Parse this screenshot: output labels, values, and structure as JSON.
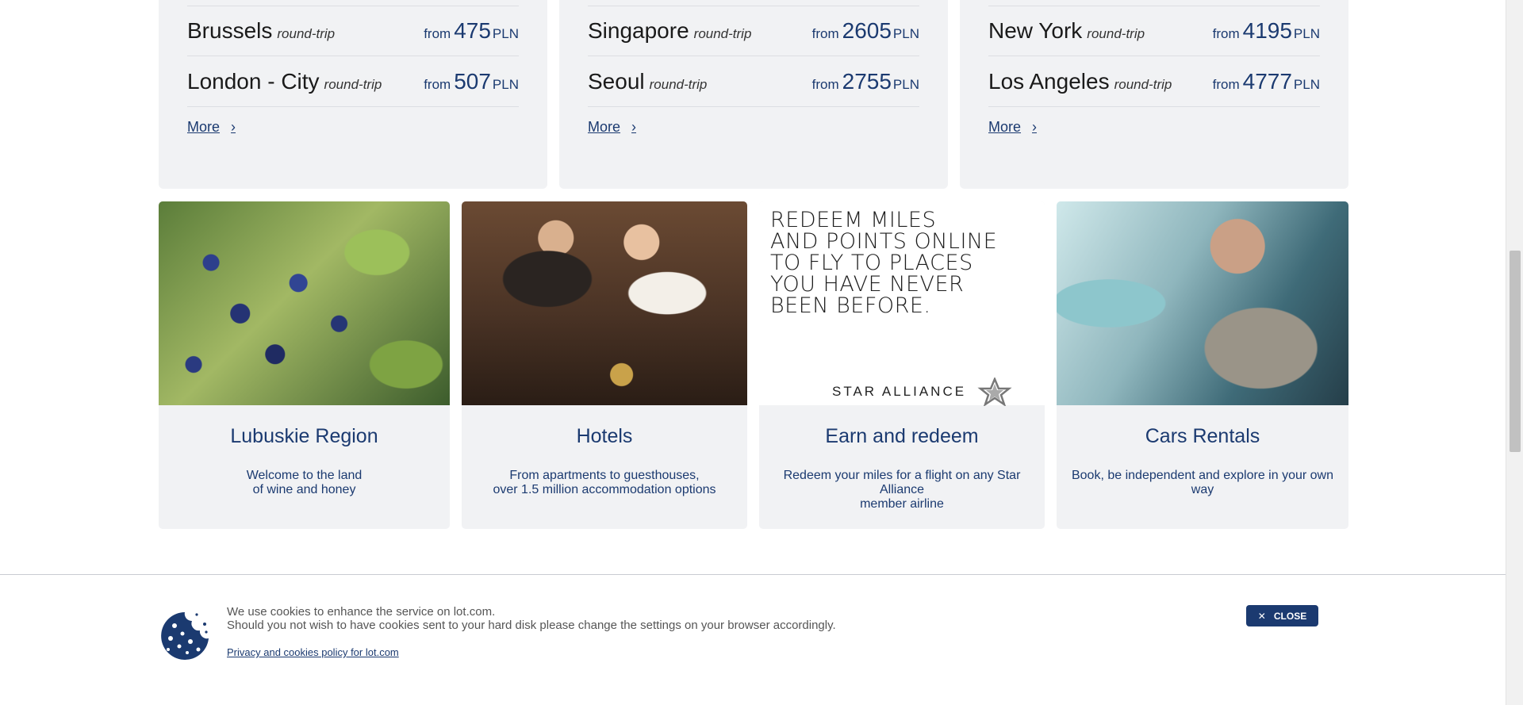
{
  "destinations": [
    {
      "rows": [
        {
          "city": "Brussels",
          "trip": "round-trip",
          "from": "from",
          "price": "475",
          "currency": "PLN"
        },
        {
          "city": "London - City",
          "trip": "round-trip",
          "from": "from",
          "price": "507",
          "currency": "PLN"
        }
      ],
      "more": "More"
    },
    {
      "rows": [
        {
          "city": "Singapore",
          "trip": "round-trip",
          "from": "from",
          "price": "2605",
          "currency": "PLN"
        },
        {
          "city": "Seoul",
          "trip": "round-trip",
          "from": "from",
          "price": "2755",
          "currency": "PLN"
        }
      ],
      "more": "More"
    },
    {
      "rows": [
        {
          "city": "New York",
          "trip": "round-trip",
          "from": "from",
          "price": "4195",
          "currency": "PLN"
        },
        {
          "city": "Los Angeles",
          "trip": "round-trip",
          "from": "from",
          "price": "4777",
          "currency": "PLN"
        }
      ],
      "more": "More"
    }
  ],
  "tiles": [
    {
      "title": "Lubuskie Region",
      "desc_line1": "Welcome to the land",
      "desc_line2": "of wine and honey"
    },
    {
      "title": "Hotels",
      "desc_line1": "From apartments to guesthouses,",
      "desc_line2": "over 1.5 million accommodation options"
    },
    {
      "title": "Earn and redeem",
      "desc_line1": "Redeem your miles for a flight on any Star Alliance",
      "desc_line2": "member airline"
    },
    {
      "title": "Cars Rentals",
      "desc_line1": "Book, be independent and explore in your own way",
      "desc_line2": ""
    }
  ],
  "star_banner": {
    "line1": "REDEEM MILES",
    "line2": "AND POINTS ONLINE",
    "line3": "TO FLY TO PLACES",
    "line4": "YOU HAVE NEVER",
    "line5": "BEEN BEFORE.",
    "brand": "STAR ALLIANCE"
  },
  "cookie": {
    "line1": "We use cookies to enhance the service on lot.com.",
    "line2": "Should you not wish to have cookies sent to your hard disk please change the settings on your browser accordingly.",
    "link": "Privacy and cookies policy for lot.com",
    "close": "CLOSE"
  },
  "colors": {
    "brand_navy": "#1b3a70",
    "card_bg": "#f1f2f4"
  }
}
